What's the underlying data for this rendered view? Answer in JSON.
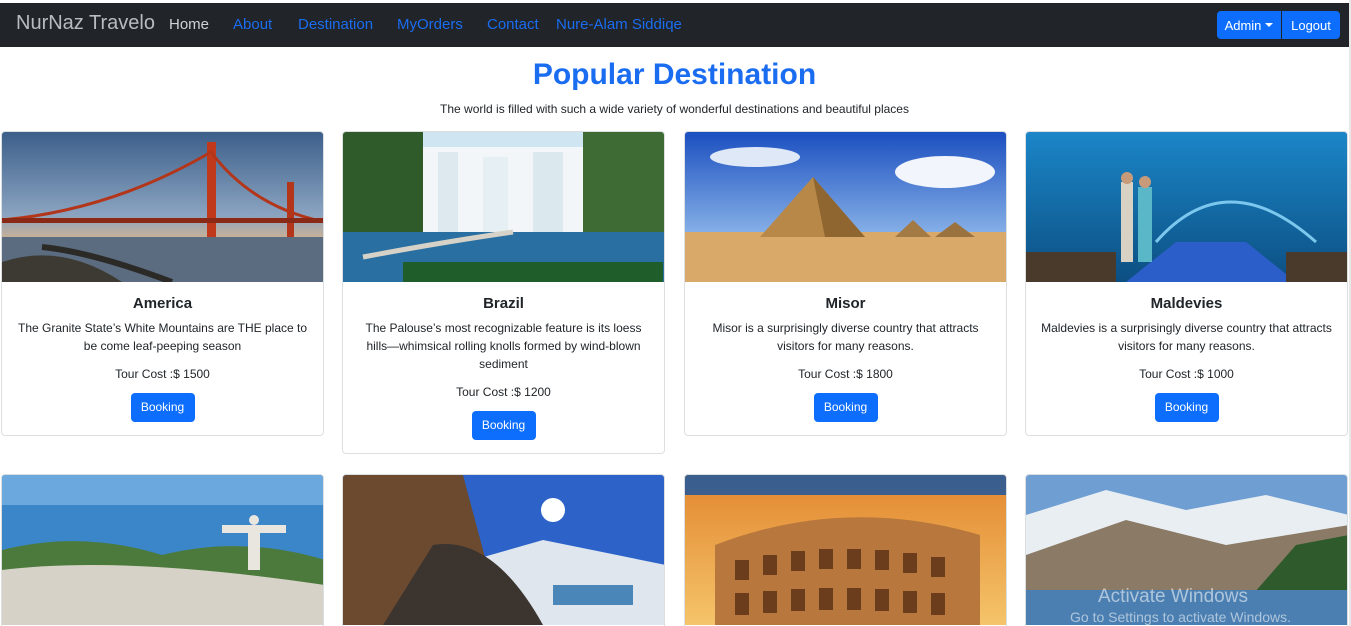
{
  "navbar": {
    "brand": "NurNaz Travelo",
    "links": [
      "Home",
      "About",
      "Destination",
      "MyOrders",
      "Contact",
      "Nure-Alam Siddiqe"
    ],
    "admin_label": "Admin",
    "logout_label": "Logout"
  },
  "hero": {
    "title": "Popular Destination",
    "subtitle": "The world is filled with such a wide variety of wonderful destinations and beautiful places"
  },
  "destinations": [
    {
      "name": "America",
      "description": "The Granite State’s White Mountains are THE place to be come leaf-peeping season",
      "cost": "Tour Cost :$ 1500",
      "button": "Booking"
    },
    {
      "name": "Brazil",
      "description": "The Palouse’s most recognizable feature is its loess hills—whimsical rolling knolls formed by wind-blown sediment",
      "cost": "Tour Cost :$ 1200",
      "button": "Booking"
    },
    {
      "name": "Misor",
      "description": "Misor is a surprisingly diverse country that attracts visitors for many reasons.",
      "cost": "Tour Cost :$ 1800",
      "button": "Booking"
    },
    {
      "name": "Maldevies",
      "description": "Maldevies is a surprisingly diverse country that attracts visitors for many reasons.",
      "cost": "Tour Cost :$ 1000",
      "button": "Booking"
    }
  ],
  "watermark": {
    "line1": "Activate Windows",
    "line2": "Go to Settings to activate Windows."
  },
  "colors": {
    "accent": "#0d6efd",
    "navbar_bg": "#212529",
    "title": "#1a6cf0"
  }
}
